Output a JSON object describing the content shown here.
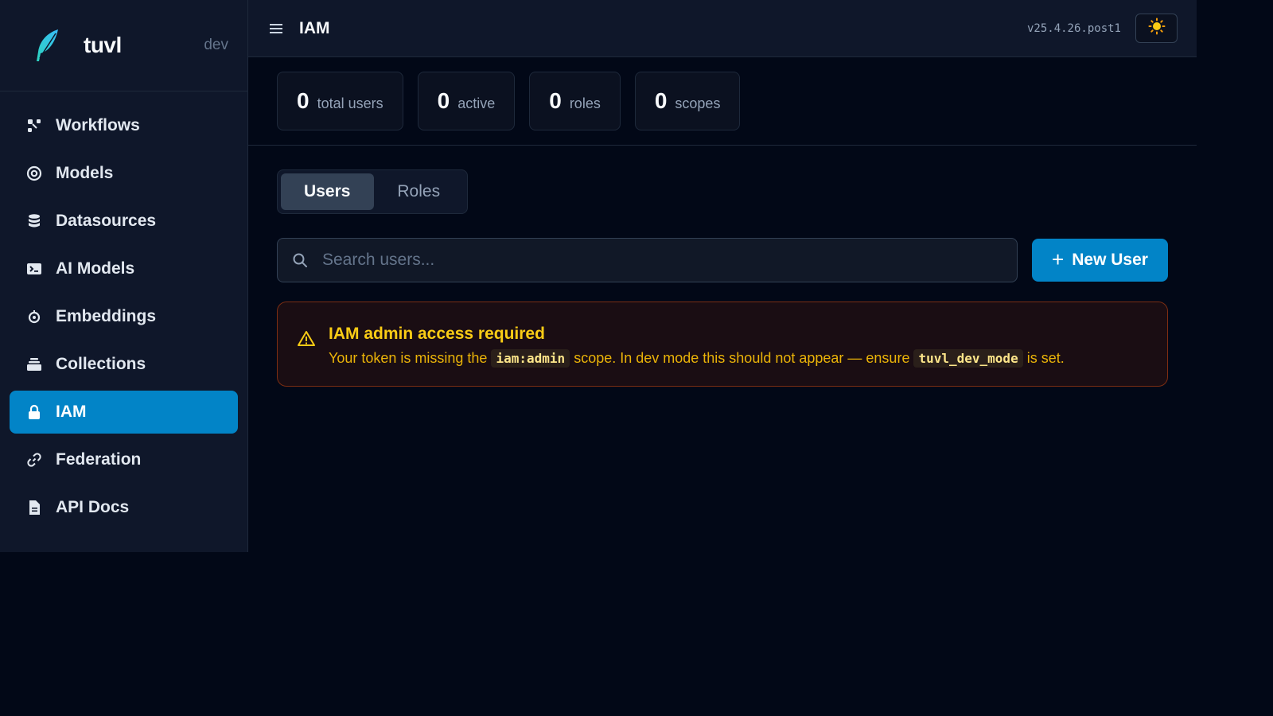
{
  "brand": {
    "name": "tuvl",
    "env": "dev",
    "logo_icon": "feather-icon"
  },
  "sidebar": {
    "items": [
      {
        "label": "Workflows",
        "icon": "workflow-icon",
        "active": false
      },
      {
        "label": "Models",
        "icon": "target-icon",
        "active": false
      },
      {
        "label": "Datasources",
        "icon": "database-icon",
        "active": false
      },
      {
        "label": "AI Models",
        "icon": "terminal-icon",
        "active": false
      },
      {
        "label": "Embeddings",
        "icon": "circle-dot-icon",
        "active": false
      },
      {
        "label": "Collections",
        "icon": "layers-icon",
        "active": false
      },
      {
        "label": "IAM",
        "icon": "lock-icon",
        "active": true
      },
      {
        "label": "Federation",
        "icon": "link-icon",
        "active": false
      },
      {
        "label": "API Docs",
        "icon": "document-icon",
        "active": false
      }
    ]
  },
  "header": {
    "title": "IAM",
    "version": "v25.4.26.post1",
    "theme_icon": "sun-icon"
  },
  "stats": [
    {
      "value": "0",
      "label": "total users"
    },
    {
      "value": "0",
      "label": "active"
    },
    {
      "value": "0",
      "label": "roles"
    },
    {
      "value": "0",
      "label": "scopes"
    }
  ],
  "tabs": [
    {
      "label": "Users",
      "active": true
    },
    {
      "label": "Roles",
      "active": false
    }
  ],
  "search": {
    "placeholder": "Search users...",
    "value": ""
  },
  "new_user_button": {
    "plus": "+",
    "label": "New User"
  },
  "alert": {
    "title": "IAM admin access required",
    "text_1": "Your token is missing the",
    "code_1": "iam:admin",
    "text_2": "scope. In dev mode this should not appear — ensure",
    "code_2": "tuvl_dev_mode",
    "text_3": "is set."
  },
  "colors": {
    "background": "#020817",
    "sidebar": "#0f172a",
    "accent": "#0284c7",
    "warning": "#facc15"
  }
}
